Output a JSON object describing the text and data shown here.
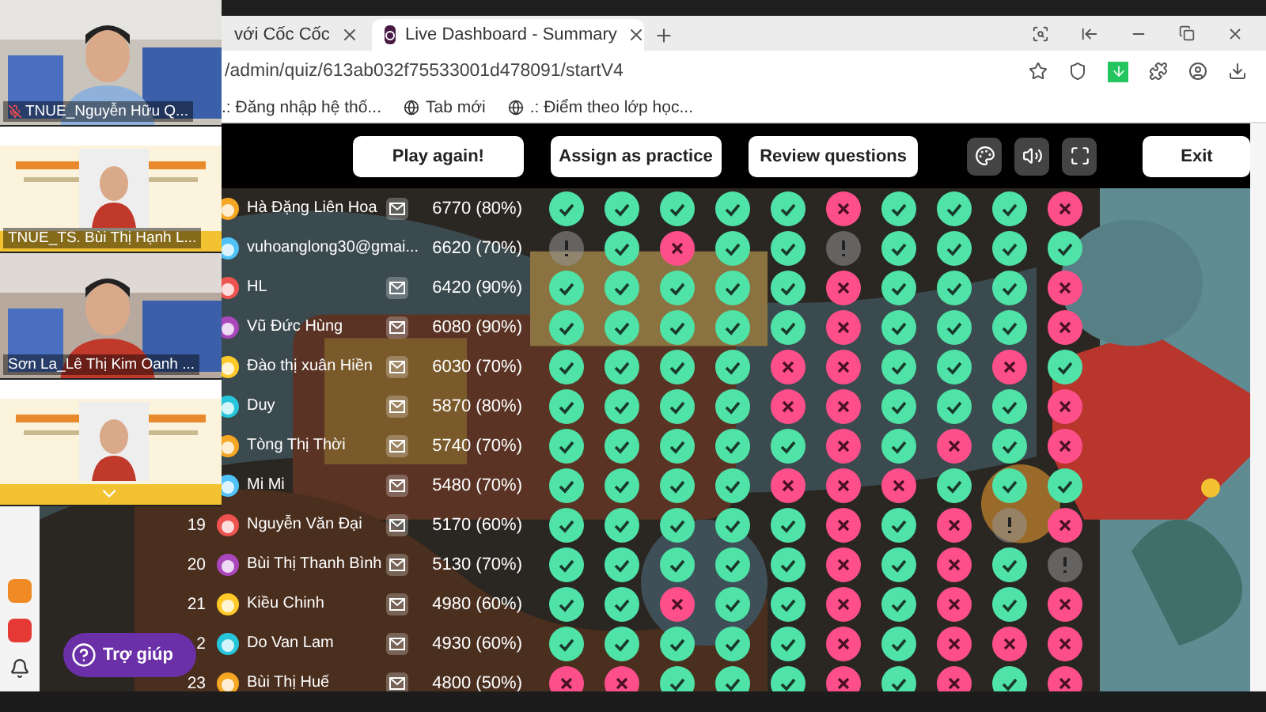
{
  "browser": {
    "tabs": [
      {
        "label": "với Cốc Cốc",
        "selected": false
      },
      {
        "label": "Live Dashboard - Summary",
        "selected": true
      }
    ],
    "address": "/admin/quiz/613ab032f75533001d478091/startV4",
    "bookmarks": [
      ".: Đăng nhập hệ thố...",
      "Tab mới",
      ".: Điểm theo lớp học..."
    ]
  },
  "toolbar": {
    "buttons": [
      "Play again!",
      "Assign as practice",
      "Review questions"
    ],
    "exit": "Exit"
  },
  "players": [
    {
      "name": "Hà Đặng Liên Hoa",
      "has_email": true,
      "score": "6770 (80%)",
      "answers": [
        {
          "answered": true,
          "correct": true
        },
        {
          "answered": true,
          "correct": true
        },
        {
          "answered": true,
          "correct": true
        },
        {
          "answered": true,
          "correct": true
        },
        {
          "answered": true,
          "correct": true
        },
        {
          "answered": true,
          "correct": false
        },
        {
          "answered": true,
          "correct": true
        },
        {
          "answered": true,
          "correct": true
        },
        {
          "answered": true,
          "correct": true
        },
        {
          "answered": true,
          "correct": false
        }
      ]
    },
    {
      "name": "vuhoanglong30@gmai...",
      "has_email": false,
      "score": "6620 (70%)",
      "answers": [
        {
          "answered": false
        },
        {
          "answered": true,
          "correct": true
        },
        {
          "answered": true,
          "correct": false
        },
        {
          "answered": true,
          "correct": true
        },
        {
          "answered": true,
          "correct": true
        },
        {
          "answered": false
        },
        {
          "answered": true,
          "correct": true
        },
        {
          "answered": true,
          "correct": true
        },
        {
          "answered": true,
          "correct": true
        },
        {
          "answered": true,
          "correct": true
        }
      ]
    },
    {
      "name": "HL",
      "has_email": true,
      "score": "6420 (90%)",
      "answers": [
        {
          "answered": true,
          "correct": true
        },
        {
          "answered": true,
          "correct": true
        },
        {
          "answered": true,
          "correct": true
        },
        {
          "answered": true,
          "correct": true
        },
        {
          "answered": true,
          "correct": true
        },
        {
          "answered": true,
          "correct": false
        },
        {
          "answered": true,
          "correct": true
        },
        {
          "answered": true,
          "correct": true
        },
        {
          "answered": true,
          "correct": true
        },
        {
          "answered": true,
          "correct": false
        }
      ]
    },
    {
      "name": "Vũ Đức Hùng",
      "has_email": true,
      "score": "6080 (90%)",
      "answers": [
        {
          "answered": true,
          "correct": true
        },
        {
          "answered": true,
          "correct": true
        },
        {
          "answered": true,
          "correct": true
        },
        {
          "answered": true,
          "correct": true
        },
        {
          "answered": true,
          "correct": true
        },
        {
          "answered": true,
          "correct": false
        },
        {
          "answered": true,
          "correct": true
        },
        {
          "answered": true,
          "correct": true
        },
        {
          "answered": true,
          "correct": true
        },
        {
          "answered": true,
          "correct": false
        }
      ]
    },
    {
      "name": "Đào thị xuân Hiền",
      "has_email": true,
      "score": "6030 (70%)",
      "answers": [
        {
          "answered": true,
          "correct": true
        },
        {
          "answered": true,
          "correct": true
        },
        {
          "answered": true,
          "correct": true
        },
        {
          "answered": true,
          "correct": true
        },
        {
          "answered": true,
          "correct": false
        },
        {
          "answered": true,
          "correct": false
        },
        {
          "answered": true,
          "correct": true
        },
        {
          "answered": true,
          "correct": true
        },
        {
          "answered": true,
          "correct": false
        },
        {
          "answered": true,
          "correct": true
        }
      ]
    },
    {
      "name": "Duy",
      "has_email": true,
      "score": "5870 (80%)",
      "answers": [
        {
          "answered": true,
          "correct": true
        },
        {
          "answered": true,
          "correct": true
        },
        {
          "answered": true,
          "correct": true
        },
        {
          "answered": true,
          "correct": true
        },
        {
          "answered": true,
          "correct": false
        },
        {
          "answered": true,
          "correct": false
        },
        {
          "answered": true,
          "correct": true
        },
        {
          "answered": true,
          "correct": true
        },
        {
          "answered": true,
          "correct": true
        },
        {
          "answered": true,
          "correct": false
        }
      ]
    },
    {
      "name": "Tòng Thị Thời",
      "has_email": true,
      "score": "5740 (70%)",
      "answers": [
        {
          "answered": true,
          "correct": true
        },
        {
          "answered": true,
          "correct": true
        },
        {
          "answered": true,
          "correct": true
        },
        {
          "answered": true,
          "correct": true
        },
        {
          "answered": true,
          "correct": true
        },
        {
          "answered": true,
          "correct": false
        },
        {
          "answered": true,
          "correct": true
        },
        {
          "answered": true,
          "correct": false
        },
        {
          "answered": true,
          "correct": true
        },
        {
          "answered": true,
          "correct": false
        }
      ]
    },
    {
      "name": "Mi Mi",
      "has_email": true,
      "score": "5480 (70%)",
      "answers": [
        {
          "answered": true,
          "correct": true
        },
        {
          "answered": true,
          "correct": true
        },
        {
          "answered": true,
          "correct": true
        },
        {
          "answered": true,
          "correct": true
        },
        {
          "answered": true,
          "correct": false
        },
        {
          "answered": true,
          "correct": false
        },
        {
          "answered": true,
          "correct": false
        },
        {
          "answered": true,
          "correct": true
        },
        {
          "answered": true,
          "correct": true
        },
        {
          "answered": true,
          "correct": true
        }
      ]
    },
    {
      "rank": "19",
      "name": "Nguyễn Văn Đại",
      "has_email": true,
      "score": "5170 (60%)",
      "answers": [
        {
          "answered": true,
          "correct": true
        },
        {
          "answered": true,
          "correct": true
        },
        {
          "answered": true,
          "correct": true
        },
        {
          "answered": true,
          "correct": true
        },
        {
          "answered": true,
          "correct": true
        },
        {
          "answered": true,
          "correct": false
        },
        {
          "answered": true,
          "correct": true
        },
        {
          "answered": true,
          "correct": false
        },
        {
          "answered": false
        },
        {
          "answered": true,
          "correct": false
        }
      ]
    },
    {
      "rank": "20",
      "name": "Bùi Thị Thanh Bình",
      "has_email": true,
      "score": "5130 (70%)",
      "answers": [
        {
          "answered": true,
          "correct": true
        },
        {
          "answered": true,
          "correct": true
        },
        {
          "answered": true,
          "correct": true
        },
        {
          "answered": true,
          "correct": true
        },
        {
          "answered": true,
          "correct": true
        },
        {
          "answered": true,
          "correct": false
        },
        {
          "answered": true,
          "correct": true
        },
        {
          "answered": true,
          "correct": false
        },
        {
          "answered": true,
          "correct": true
        },
        {
          "answered": false
        }
      ]
    },
    {
      "rank": "21",
      "name": "Kiều Chinh",
      "has_email": true,
      "score": "4980 (60%)",
      "answers": [
        {
          "answered": true,
          "correct": true
        },
        {
          "answered": true,
          "correct": true
        },
        {
          "answered": true,
          "correct": false
        },
        {
          "answered": true,
          "correct": true
        },
        {
          "answered": true,
          "correct": true
        },
        {
          "answered": true,
          "correct": false
        },
        {
          "answered": true,
          "correct": true
        },
        {
          "answered": true,
          "correct": false
        },
        {
          "answered": true,
          "correct": true
        },
        {
          "answered": true,
          "correct": false
        }
      ]
    },
    {
      "rank": "2",
      "name": "Do Van Lam",
      "has_email": true,
      "score": "4930 (60%)",
      "answers": [
        {
          "answered": true,
          "correct": true
        },
        {
          "answered": true,
          "correct": true
        },
        {
          "answered": true,
          "correct": true
        },
        {
          "answered": true,
          "correct": true
        },
        {
          "answered": true,
          "correct": true
        },
        {
          "answered": true,
          "correct": false
        },
        {
          "answered": true,
          "correct": true
        },
        {
          "answered": true,
          "correct": false
        },
        {
          "answered": true,
          "correct": false
        },
        {
          "answered": true,
          "correct": false
        }
      ]
    },
    {
      "rank": "23",
      "name": "Bùi Thị Huế",
      "has_email": true,
      "score": "4800 (50%)",
      "answers": [
        {
          "answered": true,
          "correct": false
        },
        {
          "answered": true,
          "correct": false
        },
        {
          "answered": true,
          "correct": true
        },
        {
          "answered": true,
          "correct": true
        },
        {
          "answered": true,
          "correct": true
        },
        {
          "answered": true,
          "correct": false
        },
        {
          "answered": true,
          "correct": true
        },
        {
          "answered": true,
          "correct": false
        },
        {
          "answered": true,
          "correct": true
        },
        {
          "answered": true,
          "correct": false
        }
      ]
    }
  ],
  "video_tiles": [
    {
      "kind": "camera",
      "name": "TNUE_Nguyễn Hữu Q...",
      "muted": true
    },
    {
      "kind": "slide",
      "name": "TNUE_TS. Bùi Thị Hạnh L...",
      "muted": false
    },
    {
      "kind": "camera",
      "name": "Sơn La_Lê Thị Kim Oanh ...",
      "muted": false
    },
    {
      "kind": "slide",
      "muted": false
    }
  ],
  "help_button": "Trợ giúp"
}
